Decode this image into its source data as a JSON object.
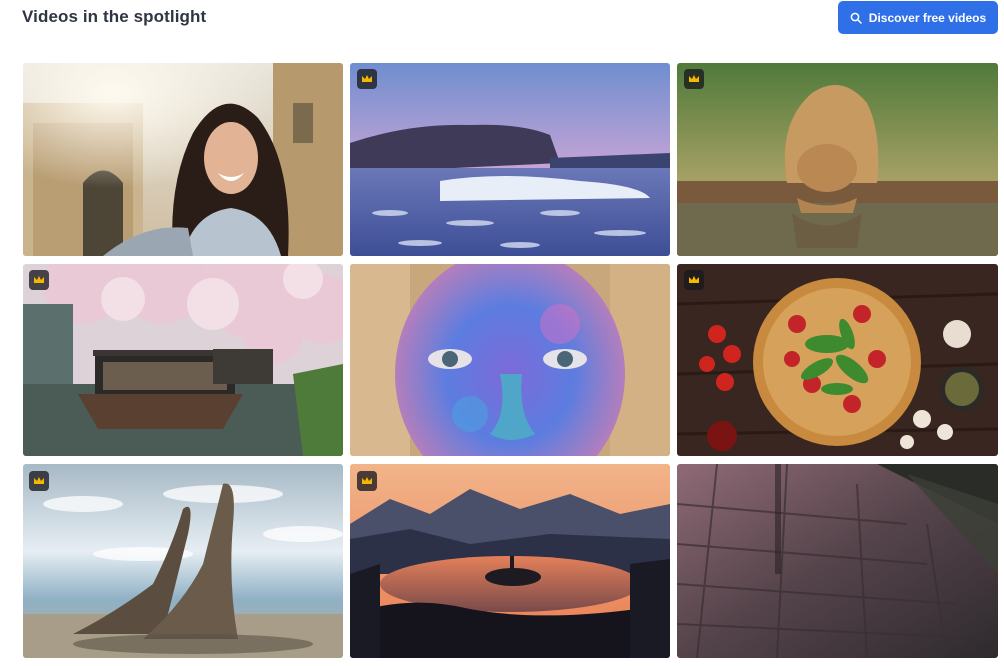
{
  "header": {
    "title": "Videos in the spotlight",
    "cta_label": "Discover free videos",
    "cta_icon": "search-icon",
    "accent": "#2f6fe8"
  },
  "videos": [
    {
      "name": "video-tile-selfie-woman",
      "subject": "woman-selfie",
      "premium": false
    },
    {
      "name": "video-tile-frozen-lake",
      "subject": "frozen-lake-cliff",
      "premium": true
    },
    {
      "name": "video-tile-lioness",
      "subject": "lioness-drinking",
      "premium": true
    },
    {
      "name": "video-tile-cherry-blossom-boat",
      "subject": "canal-boat-cherry-blossom",
      "premium": true
    },
    {
      "name": "video-tile-holi-face",
      "subject": "holi-powder-face",
      "premium": false
    },
    {
      "name": "video-tile-pizza",
      "subject": "pizza-on-table",
      "premium": true
    },
    {
      "name": "video-tile-elephant-seals",
      "subject": "elephant-seals",
      "premium": true
    },
    {
      "name": "video-tile-lake-bled",
      "subject": "lake-island-sunset",
      "premium": true
    },
    {
      "name": "video-tile-wet-pavement",
      "subject": "rainy-pavement-dusk",
      "premium": false
    }
  ],
  "premium_icon": "crown-icon",
  "premium_color": "#f5b800"
}
